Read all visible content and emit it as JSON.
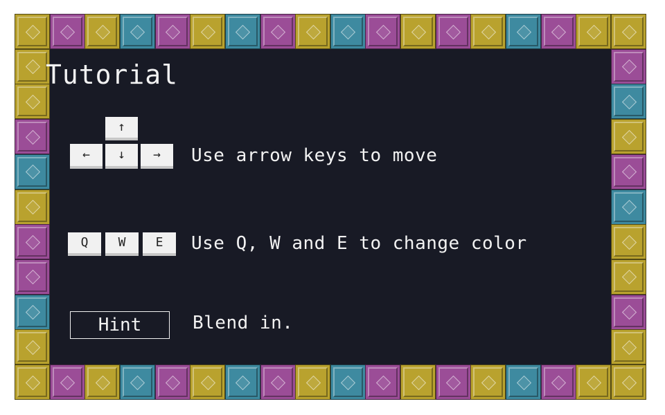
{
  "tutorial": {
    "title": "Tutorial",
    "rows": [
      {
        "keys": {
          "up": "↑",
          "left": "←",
          "down": "↓",
          "right": "→"
        },
        "text": "Use arrow keys to move"
      },
      {
        "keys": [
          "Q",
          "W",
          "E"
        ],
        "text": "Use Q, W and E to change color"
      },
      {
        "hint_label": "Hint",
        "text": "Blend in."
      }
    ]
  },
  "border": {
    "tile_colors": [
      "#b9a22e",
      "#9b4d97",
      "#3e8aa0"
    ],
    "tile_pattern": [
      "gold",
      "purple",
      "gold",
      "teal",
      "purple",
      "gold",
      "teal",
      "purple",
      "gold",
      "teal",
      "purple",
      "gold",
      "purple",
      "gold",
      "teal",
      "purple",
      "gold",
      "gold"
    ]
  }
}
